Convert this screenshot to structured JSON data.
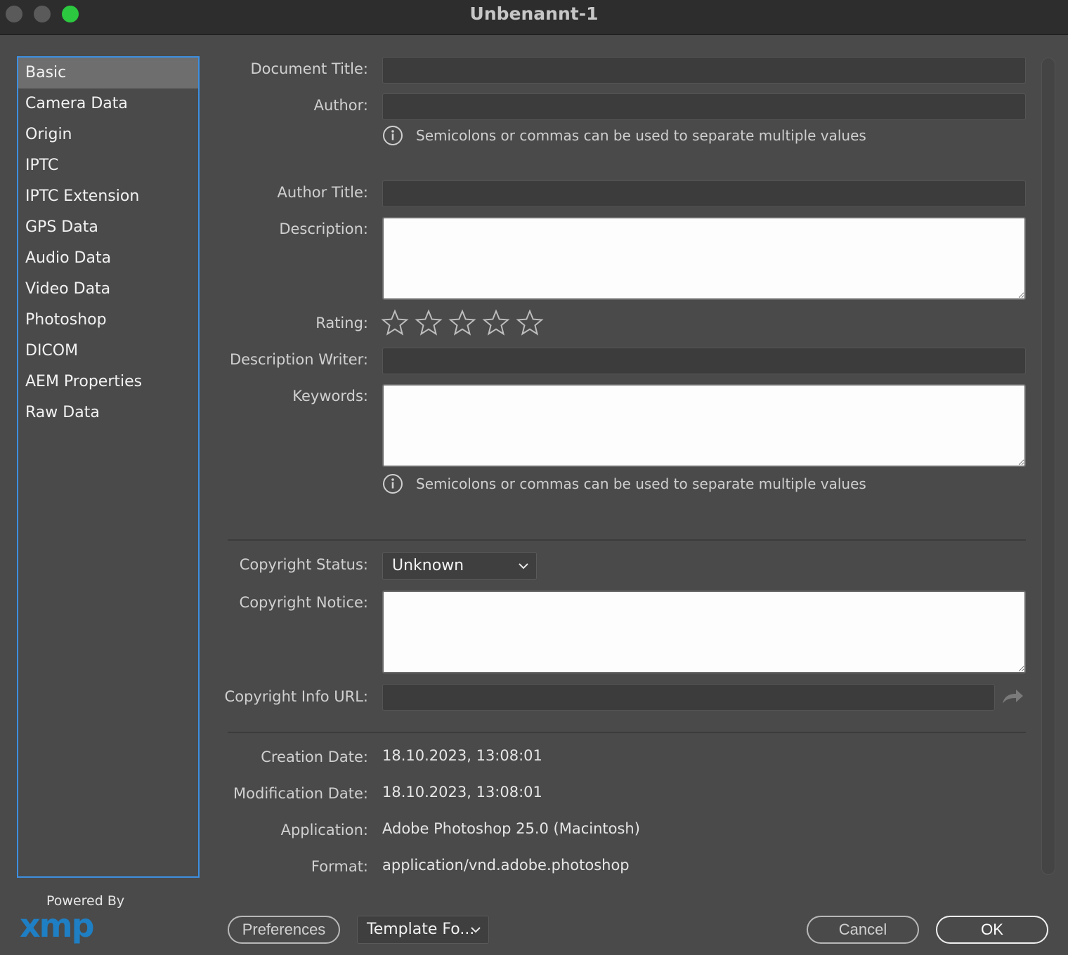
{
  "window": {
    "title": "Unbenannt-1"
  },
  "sidebar": {
    "items": [
      {
        "label": "Basic",
        "active": true
      },
      {
        "label": "Camera Data"
      },
      {
        "label": "Origin"
      },
      {
        "label": "IPTC"
      },
      {
        "label": "IPTC Extension"
      },
      {
        "label": "GPS Data"
      },
      {
        "label": "Audio Data"
      },
      {
        "label": "Video Data"
      },
      {
        "label": "Photoshop"
      },
      {
        "label": "DICOM"
      },
      {
        "label": "AEM Properties"
      },
      {
        "label": "Raw Data"
      }
    ]
  },
  "form": {
    "document_title_label": "Document Title:",
    "document_title_value": "",
    "author_label": "Author:",
    "author_value": "",
    "author_hint": "Semicolons or commas can be used to separate multiple values",
    "author_title_label": "Author Title:",
    "author_title_value": "",
    "description_label": "Description:",
    "description_value": "",
    "rating_label": "Rating:",
    "rating_value": 0,
    "rating_max": 5,
    "description_writer_label": "Description Writer:",
    "description_writer_value": "",
    "keywords_label": "Keywords:",
    "keywords_value": "",
    "keywords_hint": "Semicolons or commas can be used to separate multiple values",
    "copyright_status_label": "Copyright Status:",
    "copyright_status_value": "Unknown",
    "copyright_notice_label": "Copyright Notice:",
    "copyright_notice_value": "",
    "copyright_url_label": "Copyright Info URL:",
    "copyright_url_value": "",
    "creation_date_label": "Creation Date:",
    "creation_date_value": "18.10.2023, 13:08:01",
    "modification_date_label": "Modification Date:",
    "modification_date_value": "18.10.2023, 13:08:01",
    "application_label": "Application:",
    "application_value": "Adobe Photoshop 25.0 (Macintosh)",
    "format_label": "Format:",
    "format_value": "application/vnd.adobe.photoshop"
  },
  "footer": {
    "powered_by": "Powered By",
    "logo_text": "xmp",
    "preferences_label": "Preferences",
    "template_label": "Template Fo...",
    "cancel_label": "Cancel",
    "ok_label": "OK"
  },
  "colors": {
    "accent": "#3d8fe0",
    "window_bg": "#4a4a4a",
    "titlebar_bg": "#2d2d2d",
    "maximize_green": "#2bc840",
    "xmp_blue": "#1f7fc4"
  }
}
